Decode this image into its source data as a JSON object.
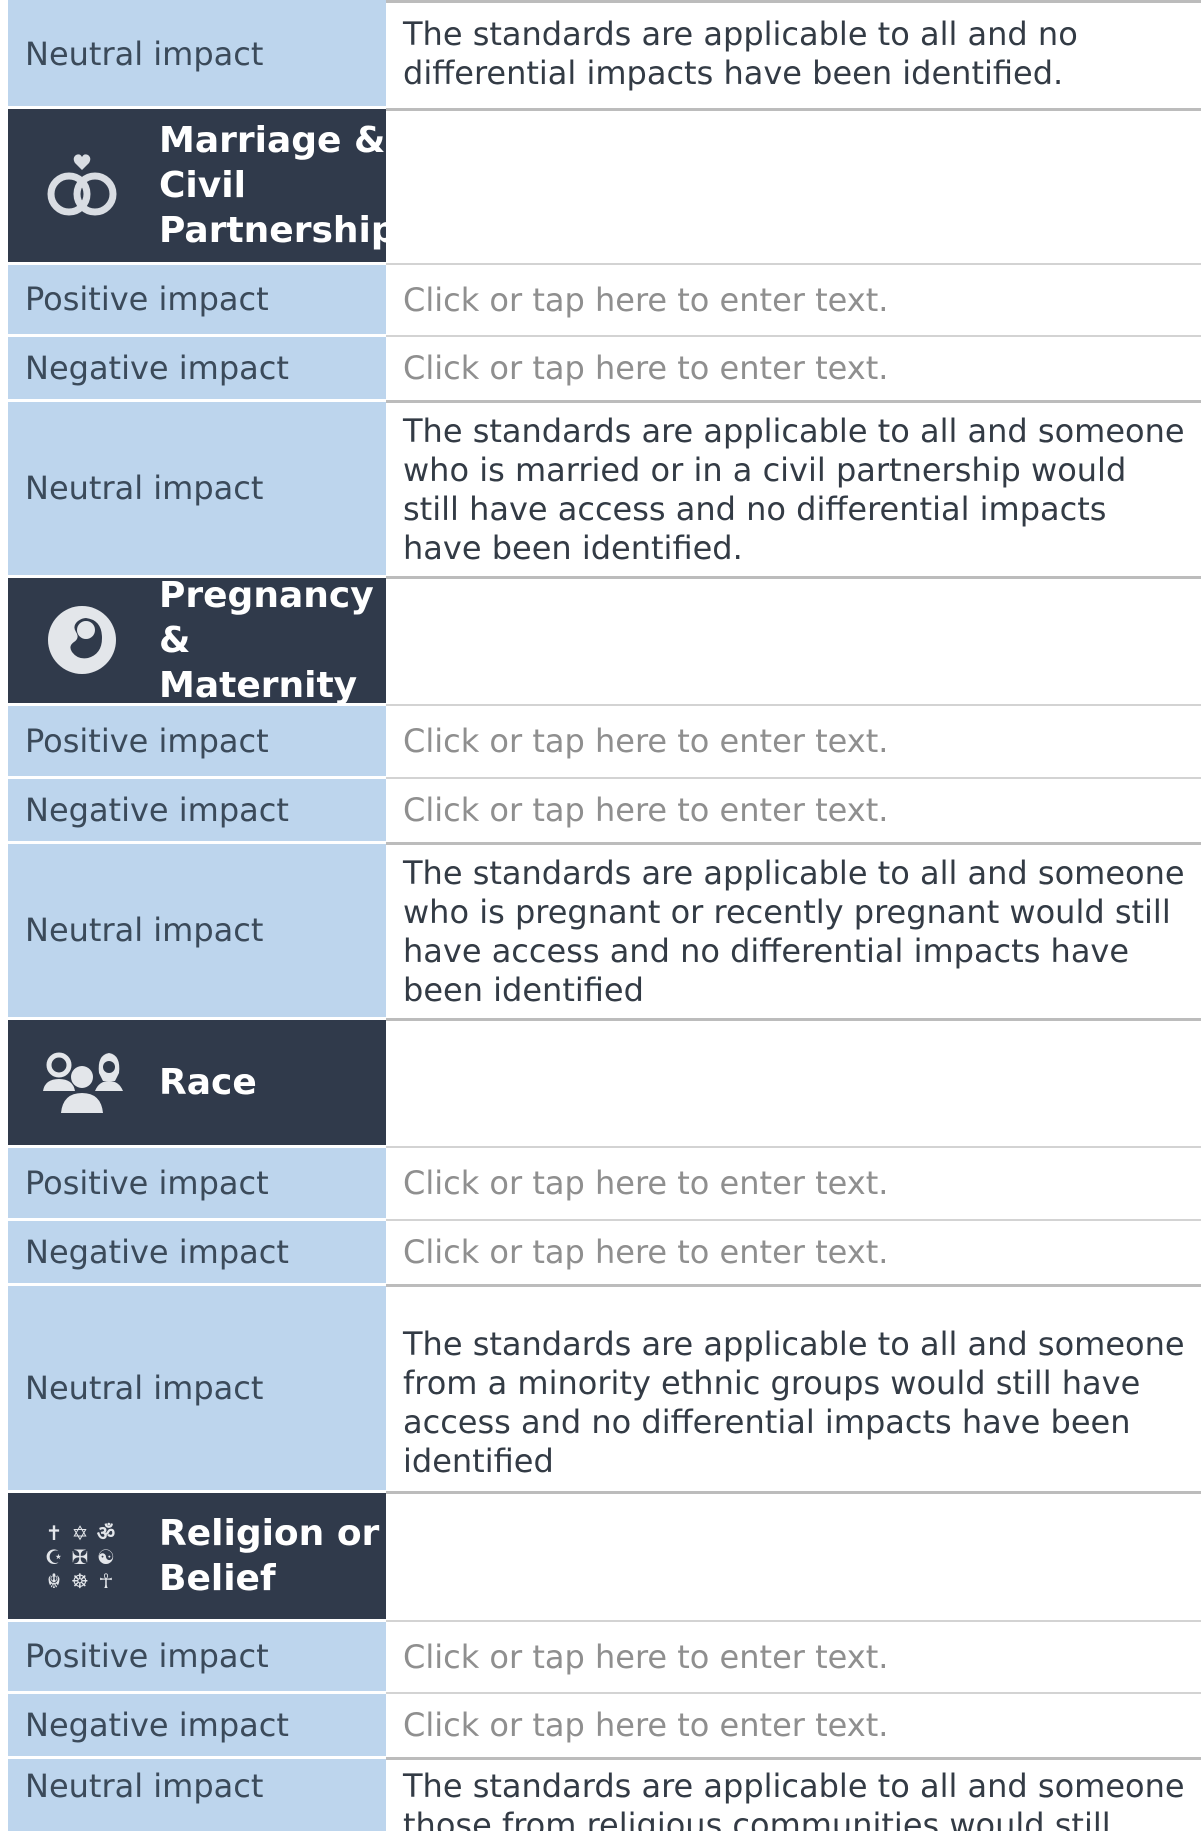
{
  "labels": {
    "positive": "Positive impact",
    "negative": "Negative impact",
    "neutral": "Neutral impact"
  },
  "placeholder": "Click or tap here to enter text.",
  "top": {
    "neutral_text": "The standards are applicable to all and no differential impacts have been identified."
  },
  "sections": [
    {
      "title": "Marriage & Civil Partnership",
      "icon": "wedding-rings-icon",
      "neutral_text": "The standards are applicable to all and someone who is married or in a civil partnership would still have access and no differential impacts have been identified."
    },
    {
      "title": "Pregnancy & Maternity",
      "icon": "fetus-icon",
      "neutral_text": "The standards are applicable to all and someone who is pregnant or recently pregnant would still have access and no differential impacts have been identified"
    },
    {
      "title": "Race",
      "icon": "people-icon",
      "neutral_text": "The standards are applicable to all and someone from a minority ethnic groups would still have access and no differential impacts have been identified"
    },
    {
      "title": "Religion or Belief",
      "icon": "religious-symbols-icon",
      "neutral_text": "The standards are applicable to all and someone those from religious communities would still have"
    }
  ],
  "colors": {
    "header_bg": "#303a4b",
    "label_bg": "#bdd5ed",
    "placeholder": "#8f8f8f"
  }
}
